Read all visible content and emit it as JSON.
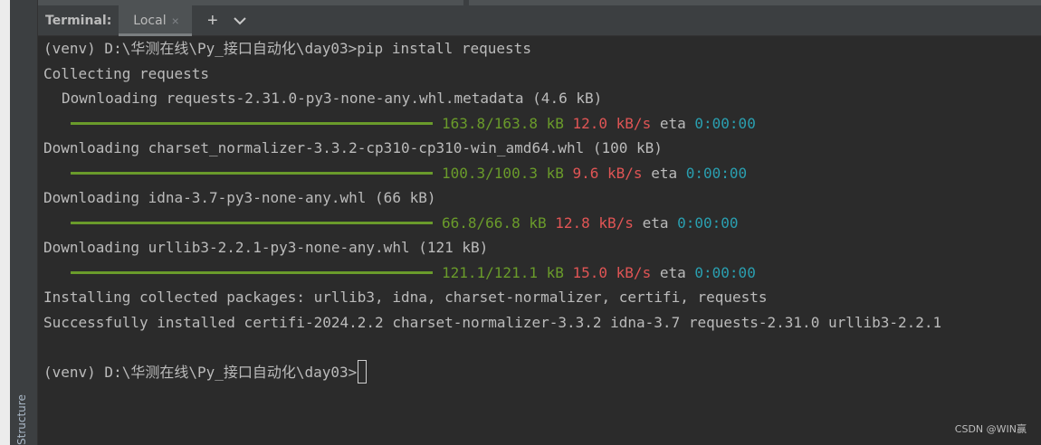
{
  "side": {
    "tab_label": "Structure"
  },
  "header": {
    "title": "Terminal:",
    "tab_label": "Local",
    "close_glyph": "×",
    "add_glyph": "+"
  },
  "terminal": {
    "prompt1": "(venv) D:\\华测在线\\Py_接口自动化\\day03>pip install requests",
    "collecting": "Collecting requests",
    "downloads": [
      {
        "text": "Downloading requests-2.31.0-py3-none-any.whl.metadata (4.6 kB)",
        "size": "163.8/163.8 kB",
        "speed": "12.0 kB/s",
        "eta_label": "eta",
        "eta": "0:00:00"
      },
      {
        "text": "Downloading charset_normalizer-3.3.2-cp310-cp310-win_amd64.whl (100 kB)",
        "size": "100.3/100.3 kB",
        "speed": "9.6 kB/s",
        "eta_label": "eta",
        "eta": "0:00:00"
      },
      {
        "text": "Downloading idna-3.7-py3-none-any.whl (66 kB)",
        "size": "66.8/66.8 kB",
        "speed": "12.8 kB/s",
        "eta_label": "eta",
        "eta": "0:00:00"
      },
      {
        "text": "Downloading urllib3-2.2.1-py3-none-any.whl (121 kB)",
        "size": "121.1/121.1 kB",
        "speed": "15.0 kB/s",
        "eta_label": "eta",
        "eta": "0:00:00"
      }
    ],
    "installing": "Installing collected packages: urllib3, idna, charset-normalizer, certifi, requests",
    "success": "Successfully installed certifi-2024.2.2 charset-normalizer-3.3.2 idna-3.7 requests-2.31.0 urllib3-2.2.1",
    "prompt2": "(venv) D:\\华测在线\\Py_接口自动化\\day03>"
  },
  "watermark": "CSDN @WIN赢",
  "colors": {
    "progress": "#6a9b2b",
    "speed": "#e05555",
    "eta": "#2a9fb0",
    "background": "#2b2b2b"
  }
}
